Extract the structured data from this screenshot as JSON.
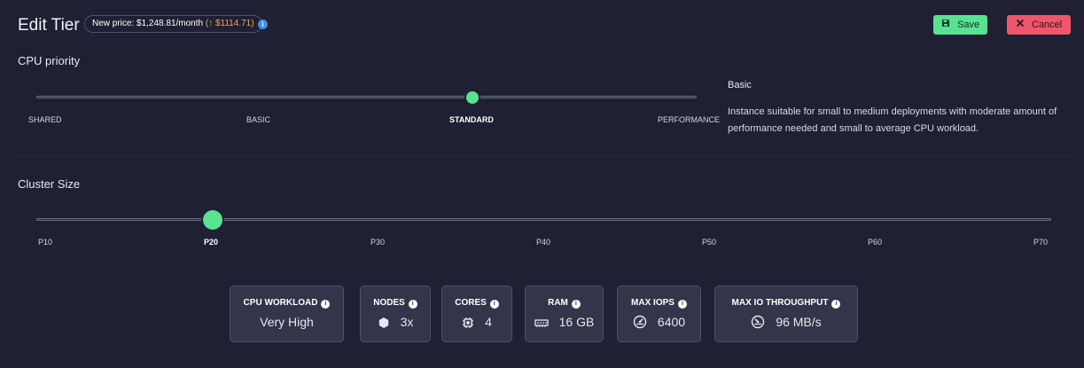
{
  "header": {
    "title": "Edit Tier",
    "price_prefix": "New price: $1,248.81/month ",
    "price_delta": "(↑ $1114.71)",
    "info_icon": "i",
    "save_label": "Save",
    "cancel_label": "Cancel"
  },
  "cpu_priority": {
    "title": "CPU priority",
    "ticks": [
      "SHARED",
      "BASIC",
      "STANDARD",
      "PERFORMANCE"
    ],
    "selected": "STANDARD",
    "description_title": "Basic",
    "description": "Instance suitable for small to medium deployments with moderate amount of performance needed and small to average CPU workload."
  },
  "cluster_size": {
    "title": "Cluster Size",
    "ticks": [
      "P10",
      "P20",
      "P30",
      "P40",
      "P50",
      "P60",
      "P70"
    ],
    "selected": "P20"
  },
  "specs": [
    {
      "label": "CPU WORKLOAD",
      "value": "Very High",
      "icon": ""
    },
    {
      "label": "NODES",
      "value": "3x",
      "icon": "hexagon-icon"
    },
    {
      "label": "CORES",
      "value": "4",
      "icon": "cpu-chip-icon"
    },
    {
      "label": "RAM",
      "value": "16 GB",
      "icon": "memory-icon"
    },
    {
      "label": "MAX IOPS",
      "value": "6400",
      "icon": "speedometer-icon"
    },
    {
      "label": "MAX IO THROUGHPUT",
      "value": "96 MB/s",
      "icon": "speedometer-icon"
    }
  ],
  "colors": {
    "background": "#1f2033",
    "accent_green": "#56e493",
    "danger_red": "#f0566a",
    "price_delta_orange": "#f0a45c",
    "info_blue": "#3d8ef0",
    "card_bg": "#33354a"
  }
}
